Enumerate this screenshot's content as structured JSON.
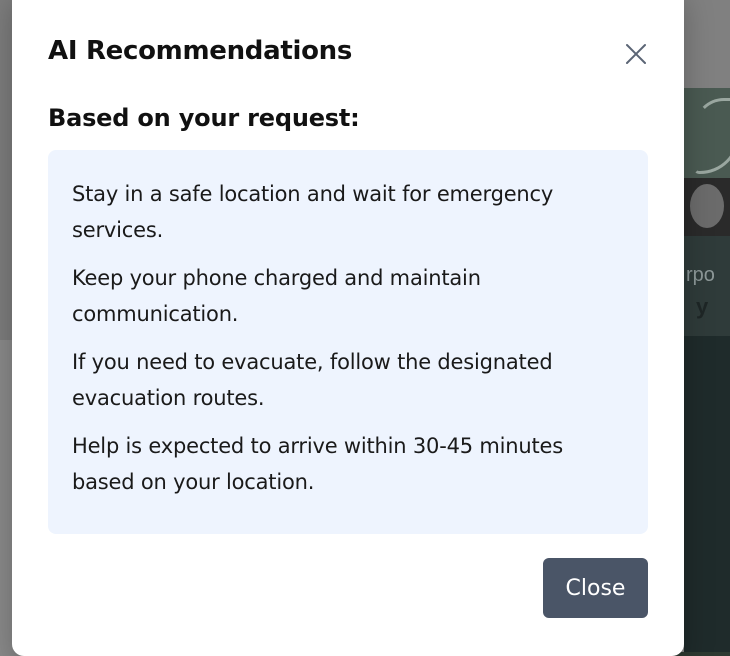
{
  "modal": {
    "title": "AI Recommendations",
    "section_label": "Based on your request:",
    "recommendations": [
      "Stay in a safe location and wait for emergency services.",
      "Keep your phone charged and maintain communication.",
      "If you need to evacuate, follow the designated evacuation routes.",
      "Help is expected to arrive within 30-45 minutes based on your location."
    ],
    "close_button_label": "Close",
    "close_icon": "close-icon"
  },
  "background": {
    "partial_text_1": "rpo",
    "partial_text_2": "y"
  },
  "colors": {
    "recommendation_box": "#eef4fe",
    "close_button": "#4a5567",
    "overlay": "#8a8a8a"
  }
}
